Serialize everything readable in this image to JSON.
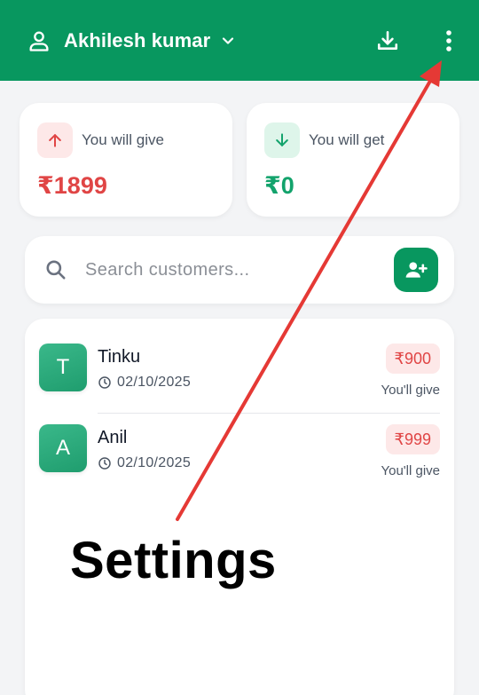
{
  "header": {
    "user_name": "Akhilesh kumar",
    "icons": [
      "user-icon",
      "chevron-down-icon",
      "download-icon",
      "more-vertical-icon"
    ]
  },
  "summary": {
    "give": {
      "label": "You will give",
      "value": "₹1899",
      "icon": "arrow-up-icon"
    },
    "get": {
      "label": "You will get",
      "value": "₹0",
      "icon": "arrow-down-icon"
    }
  },
  "search": {
    "placeholder": "Search customers...",
    "add_icon": "add-customer-icon"
  },
  "customers": [
    {
      "initial": "T",
      "name": "Tinku",
      "date": "02/10/2025",
      "amount": "₹900",
      "note": "You'll give"
    },
    {
      "initial": "A",
      "name": "Anil",
      "date": "02/10/2025",
      "amount": "₹999",
      "note": "You'll give"
    }
  ],
  "annotation": {
    "label": "Settings",
    "arrow_color": "#e53935"
  },
  "colors": {
    "brand": "#08975f",
    "give": "#e04545",
    "get": "#13a36c"
  }
}
